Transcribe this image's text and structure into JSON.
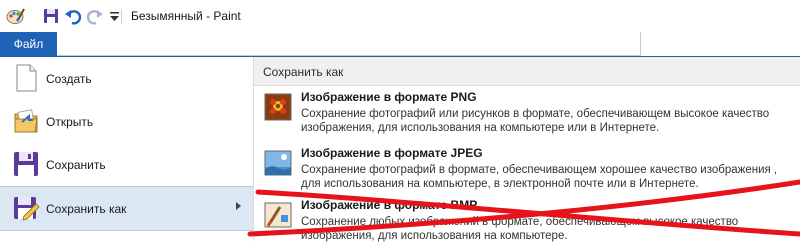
{
  "window": {
    "title": "Безымянный - Paint"
  },
  "ribbon": {
    "file_tab": "Файл"
  },
  "menu": {
    "items": [
      {
        "label": "Создать",
        "icon": "new-document-icon"
      },
      {
        "label": "Открыть",
        "icon": "open-folder-icon"
      },
      {
        "label": "Сохранить",
        "icon": "save-floppy-icon"
      },
      {
        "label": "Сохранить как",
        "icon": "save-as-icon"
      }
    ]
  },
  "save_as": {
    "header": "Сохранить как",
    "options": [
      {
        "title": "Изображение в формате PNG",
        "description": "Сохранение фотографий или рисунков в формате, обеспечивающем высокое качество изображения, для использования на компьютере или в Интернете.",
        "icon": "png-image-icon"
      },
      {
        "title": "Изображение в формате JPEG",
        "description": "Сохранение фотографий в формате, обеспечивающем хорошее качество изображения , для использования на компьютере, в электронной почте или в Интернете.",
        "icon": "jpeg-image-icon"
      },
      {
        "title": "Изображение в формате BMP",
        "description": "Сохранение любых изображений в формате, обеспечивающем высокое качество изображения, для использования на компьютере.",
        "icon": "bmp-image-icon"
      }
    ]
  },
  "colors": {
    "accent": "#1f63b8",
    "annotation": "#e8121b"
  }
}
